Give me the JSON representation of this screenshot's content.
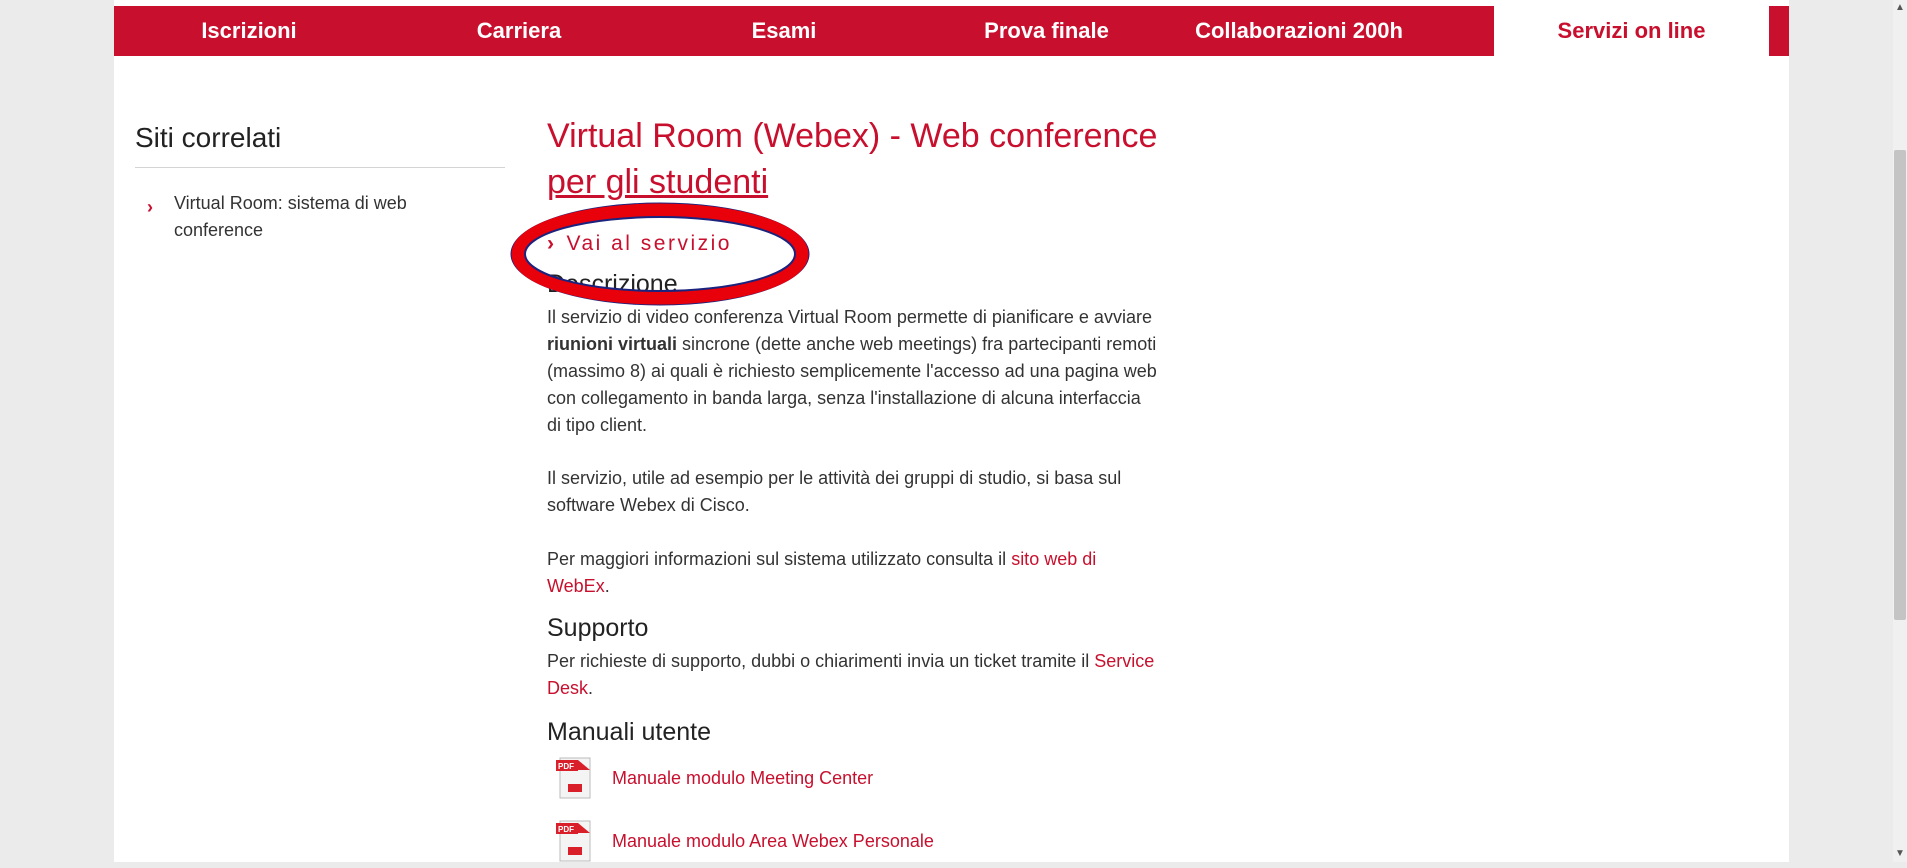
{
  "nav": {
    "items": [
      {
        "label": "Iscrizioni"
      },
      {
        "label": "Carriera"
      },
      {
        "label": "Esami"
      },
      {
        "label": "Prova finale"
      },
      {
        "label": "Collaborazioni 200h"
      },
      {
        "label": "Servizi on line"
      }
    ]
  },
  "sidebar": {
    "title": "Siti correlati",
    "items": [
      {
        "label": "Virtual Room: sistema di web conference"
      }
    ]
  },
  "main": {
    "title_line1": "Virtual Room (Webex) - Web conference",
    "title_line2": "per gli studenti",
    "service_link": "Vai al servizio",
    "description": {
      "heading": "Descrizione",
      "p1_a": "Il servizio di video conferenza Virtual Room permette di pianificare e avviare ",
      "p1_bold": "riunioni virtuali",
      "p1_b": " sincrone (dette anche web meetings) fra partecipanti remoti (massimo 8) ai quali è richiesto semplicemente l'accesso ad una pagina web con collegamento in banda larga, senza l'installazione di alcuna interfaccia di tipo client.",
      "p2": "Il servizio, utile ad esempio per le attività dei gruppi di studio, si basa sul software Webex di Cisco.",
      "p3_a": "Per maggiori informazioni sul sistema utilizzato consulta il ",
      "p3_link": "sito web di WebEx",
      "p3_b": "."
    },
    "support": {
      "heading": "Supporto",
      "p_a": "Per richieste di supporto, dubbi o chiarimenti invia un ticket tramite il ",
      "p_link": "Service Desk",
      "p_b": "."
    },
    "manuals": {
      "heading": "Manuali utente",
      "items": [
        {
          "label": "Manuale modulo Meeting Center",
          "icon": "pdf-icon"
        },
        {
          "label": "Manuale modulo Area Webex Personale",
          "icon": "pdf-icon"
        }
      ]
    }
  },
  "colors": {
    "accent": "#c8102e",
    "annotation": "#e8000a"
  }
}
